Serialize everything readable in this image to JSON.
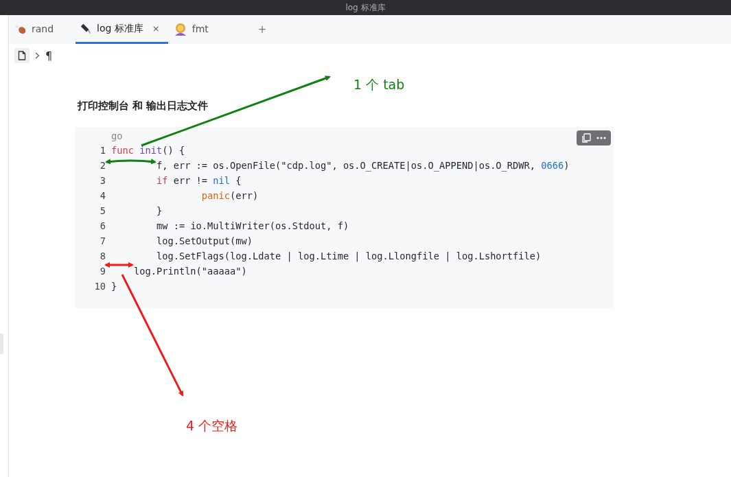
{
  "window": {
    "title": "log 标准库"
  },
  "tabs": [
    {
      "label": "rand",
      "selected": false
    },
    {
      "label": "log 标准库",
      "selected": true,
      "close": "×"
    },
    {
      "label": "fmt",
      "selected": false
    }
  ],
  "new_tab": "+",
  "breadcrumb": {
    "mark": "¶"
  },
  "heading": "打印控制台 和 输出日志文件",
  "code": {
    "language": "go",
    "lines": [
      {
        "number": "1",
        "tokens": [
          {
            "kind": "keyword",
            "text": "func"
          },
          {
            "kind": "func",
            "text": " init"
          },
          {
            "kind": "plain",
            "text": "() {"
          }
        ]
      },
      {
        "number": "2",
        "tokens": [
          {
            "kind": "plain",
            "text": "\tf, err := os.OpenFile(\"cdp.log\", os.O_CREATE|os.O_APPEND|os.O_RDWR, "
          },
          {
            "kind": "number",
            "text": "0666"
          },
          {
            "kind": "plain",
            "text": ")"
          }
        ]
      },
      {
        "number": "3",
        "tokens": [
          {
            "kind": "keyword",
            "text": "\tif"
          },
          {
            "kind": "plain",
            "text": " err != "
          },
          {
            "kind": "number",
            "text": "nil"
          },
          {
            "kind": "plain",
            "text": " {"
          }
        ]
      },
      {
        "number": "4",
        "tokens": [
          {
            "kind": "builtin",
            "text": "\t\tpanic"
          },
          {
            "kind": "plain",
            "text": "(err)"
          }
        ]
      },
      {
        "number": "5",
        "tokens": [
          {
            "kind": "plain",
            "text": "\t}"
          }
        ]
      },
      {
        "number": "6",
        "tokens": [
          {
            "kind": "plain",
            "text": "\tmw := io.MultiWriter(os.Stdout, f)"
          }
        ]
      },
      {
        "number": "7",
        "tokens": [
          {
            "kind": "plain",
            "text": "\tlog.SetOutput(mw)"
          }
        ]
      },
      {
        "number": "8",
        "tokens": [
          {
            "kind": "plain",
            "text": "\tlog.SetFlags(log.Ldate | log.Ltime | log.Llongfile | log.Lshortfile)"
          }
        ]
      },
      {
        "number": "9",
        "tokens": [
          {
            "kind": "plain",
            "text": "    log.Println(\"aaaaa\")"
          }
        ]
      },
      {
        "number": "10",
        "tokens": [
          {
            "kind": "plain",
            "text": "}"
          }
        ]
      }
    ]
  },
  "annotations": [
    {
      "text": "1 个 tab",
      "color": "#108010"
    },
    {
      "text": "4 个空格",
      "color": "#ee1c1c"
    }
  ]
}
